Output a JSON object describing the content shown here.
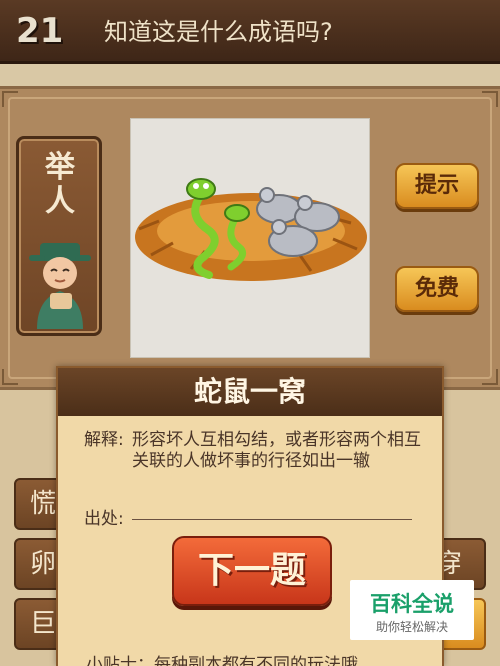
{
  "header": {
    "level": "21",
    "question": "知道这是什么成语吗?"
  },
  "character": {
    "name_line1": "举",
    "name_line2": "人"
  },
  "buttons": {
    "hint": "提示",
    "free": "免费"
  },
  "answer_tiles": {
    "left": [
      "慌",
      "卵",
      "巨"
    ],
    "right": [
      "穿"
    ]
  },
  "popup": {
    "idiom": "蛇鼠一窝",
    "explain_label": "解释:",
    "explain_text": "形容坏人互相勾结，或者形容两个相互关联的人做坏事的行径如出一辙",
    "source_label": "出处:",
    "next_button": "下一题",
    "tip": "小贴士：每种副本都有不同的玩法哦"
  },
  "watermark": {
    "brand": "百科全说",
    "slogan": "助你轻松解决"
  },
  "colors": {
    "header_bg": "#4a2e1b",
    "panel_bg": "#ae885f",
    "button_orange": "#f0a63a",
    "next_button_red": "#e0502a"
  }
}
